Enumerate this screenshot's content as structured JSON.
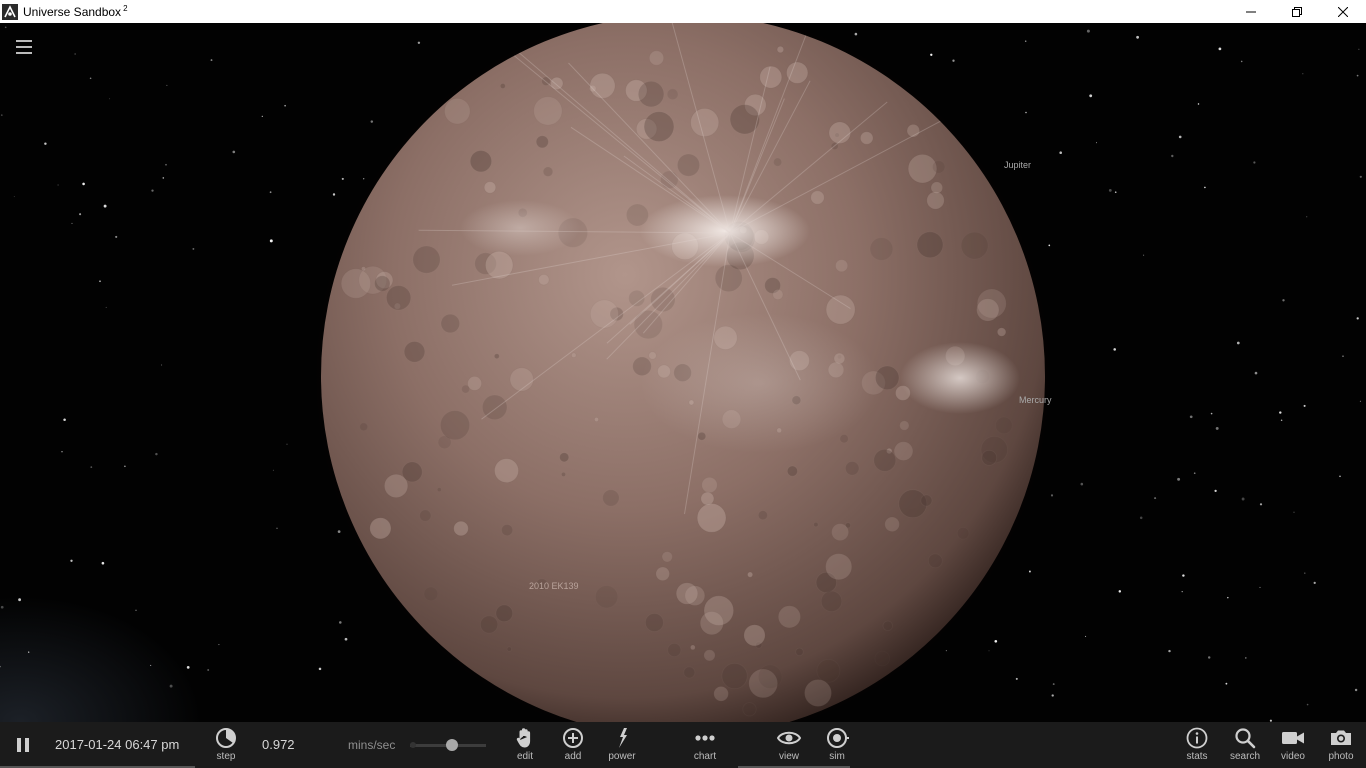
{
  "window": {
    "title": "Universe Sandbox",
    "title_superscript": "2",
    "minimize_icon": "minimize-icon",
    "maximize_icon": "restore-icon",
    "close_icon": "close-icon"
  },
  "viewport": {
    "menu_icon": "hamburger-menu-icon",
    "labels": {
      "jupiter": "Jupiter",
      "mercury": "Mercury",
      "object": "2010 EK139"
    },
    "planet_colors": [
      "#b1958b",
      "#8c6f66",
      "#5e4740",
      "#2c1e1a"
    ]
  },
  "bottom_bar": {
    "pause_icon": "pause-icon",
    "datetime": "2017-01-24 06:47 pm",
    "rate_value": "0.972",
    "rate_unit": "mins/sec",
    "speed_slider_level": 0.55,
    "step": {
      "label": "step",
      "icon": "step-icon"
    },
    "tools": [
      {
        "id": "edit",
        "label": "edit",
        "icon": "hand-icon"
      },
      {
        "id": "add",
        "label": "add",
        "icon": "plus-circle-icon"
      },
      {
        "id": "power",
        "label": "power",
        "icon": "power-tool-icon"
      },
      {
        "id": "chart",
        "label": "chart",
        "icon": "dots-chart-icon"
      },
      {
        "id": "view",
        "label": "view",
        "icon": "eye-icon"
      },
      {
        "id": "sim",
        "label": "sim",
        "icon": "target-icon"
      }
    ],
    "right_tools": [
      {
        "id": "stats",
        "label": "stats",
        "icon": "info-icon"
      },
      {
        "id": "search",
        "label": "search",
        "icon": "search-icon"
      },
      {
        "id": "video",
        "label": "video",
        "icon": "video-camera-icon"
      },
      {
        "id": "photo",
        "label": "photo",
        "icon": "camera-icon"
      }
    ]
  }
}
